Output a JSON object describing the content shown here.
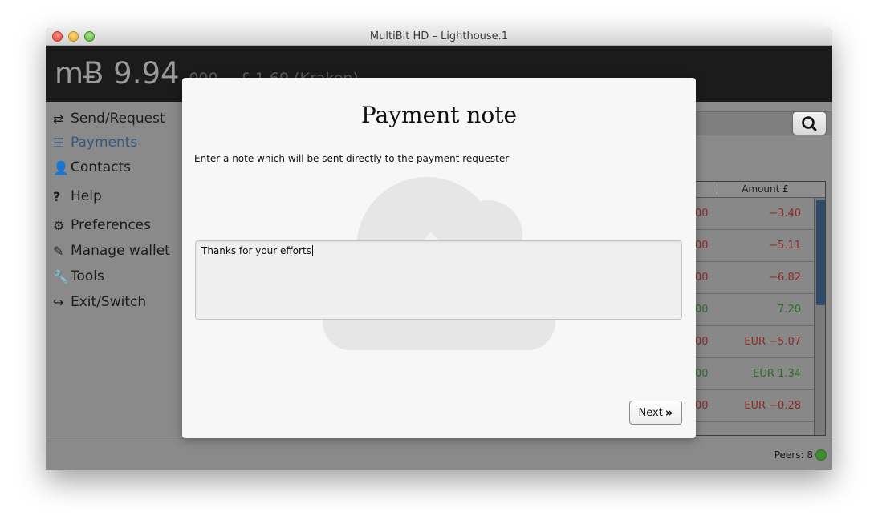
{
  "window": {
    "title": "MultiBit HD – Lighthouse.1"
  },
  "header": {
    "balance": "mɃ 9.94",
    "balance_sub": "000 ~ £ 1.69 (Kraken)"
  },
  "sidebar": {
    "items": [
      {
        "label": "Send/Request",
        "icon": "exchange-icon",
        "glyph": "⇄"
      },
      {
        "label": "Payments",
        "icon": "list-icon",
        "glyph": "☰"
      },
      {
        "label": "Contacts",
        "icon": "user-icon",
        "glyph": "👤"
      },
      {
        "label": "Help",
        "icon": "question-icon",
        "glyph": "?"
      },
      {
        "label": "Preferences",
        "icon": "gears-icon",
        "glyph": "⚙"
      },
      {
        "label": "Manage wallet",
        "icon": "edit-icon",
        "glyph": "✎"
      },
      {
        "label": "Tools",
        "icon": "wrench-icon",
        "glyph": "🔧"
      },
      {
        "label": "Exit/Switch",
        "icon": "sign-out-icon",
        "glyph": "↪"
      }
    ]
  },
  "search": {
    "icon": "search-icon"
  },
  "table": {
    "column_amount": "Amount £",
    "rows": [
      {
        "left": "00",
        "amount": "−3.40",
        "status": "negative"
      },
      {
        "left": "00",
        "amount": "−5.11",
        "status": "negative"
      },
      {
        "left": "00",
        "amount": "−6.82",
        "status": "negative"
      },
      {
        "left": "00",
        "amount": "7.20",
        "status": "positive"
      },
      {
        "left": "00",
        "amount": "EUR −5.07",
        "status": "negative"
      },
      {
        "left": "00",
        "amount": "EUR 1.34",
        "status": "positive"
      },
      {
        "left": "00",
        "amount": "EUR −0.28",
        "status": "negative"
      }
    ]
  },
  "footer": {
    "peers": "Peers: 8"
  },
  "modal": {
    "title": "Payment note",
    "description": "Enter a note which will be sent directly to the payment requester",
    "note_value": "Thanks for your efforts",
    "next_label": "Next"
  },
  "colors": {
    "negative": "#8e2a28",
    "positive": "#2f6b2b",
    "active_nav": "#34587f",
    "peer_status": "#3f8e2e"
  }
}
